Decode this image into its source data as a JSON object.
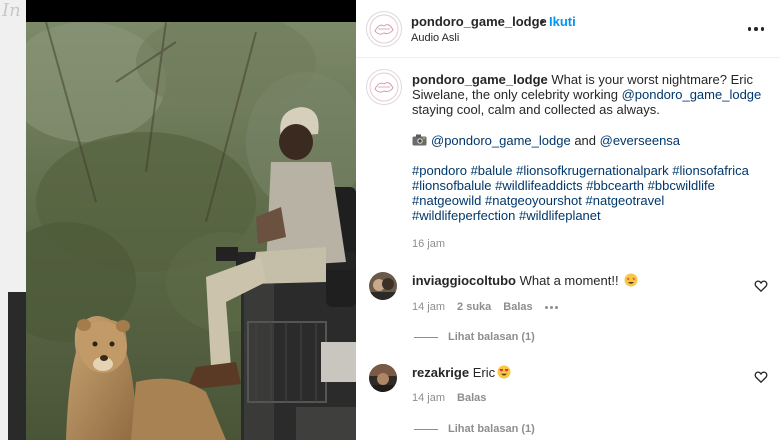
{
  "backdrop": {
    "text": "In"
  },
  "post": {
    "username": "pondoro_game_lodge",
    "separator": "•",
    "follow_label": "Ikuti",
    "audio_label": "Audio Asli",
    "more_icon": "more-horizontal-icon",
    "caption": {
      "username": "pondoro_game_lodge",
      "text_1": " What is your worst nightmare? Eric Siwelane, the only celebrity working ",
      "mention_1": "@pondoro_game_lodge",
      "text_2": " staying cool, calm and collected as always.",
      "camera_icon": "camera-icon",
      "credit_mention_1": "@pondoro_game_lodge",
      "credit_and": " and ",
      "credit_mention_2": "@everseensa",
      "hashtags": [
        "#pondoro",
        "#balule",
        "#lionsofkrugernationalpark",
        "#lionsofafrica",
        "#lionsofbalule",
        "#wildlifeaddicts",
        "#bbcearth",
        "#bbcwildlife",
        "#natgeowild",
        "#natgeoyourshot",
        "#natgeotravel",
        "#wildlifeperfection",
        "#wildlifeplanet"
      ],
      "time": "16 jam"
    }
  },
  "comments": [
    {
      "username": "inviaggiocoltubo",
      "text": "What a moment!!",
      "emoji": "star-struck-emoji",
      "time": "14 jam",
      "likes": "2 suka",
      "reply_label": "Balas",
      "view_replies": "Lihat balasan (1)"
    },
    {
      "username": "rezakrige",
      "text": "Eric",
      "emoji": "heart-eyes-emoji",
      "time": "14 jam",
      "reply_label": "Balas",
      "view_replies": "Lihat balasan (1)"
    }
  ],
  "colors": {
    "link": "#00376b",
    "follow": "#0095f6",
    "muted": "#8e8e8e"
  }
}
